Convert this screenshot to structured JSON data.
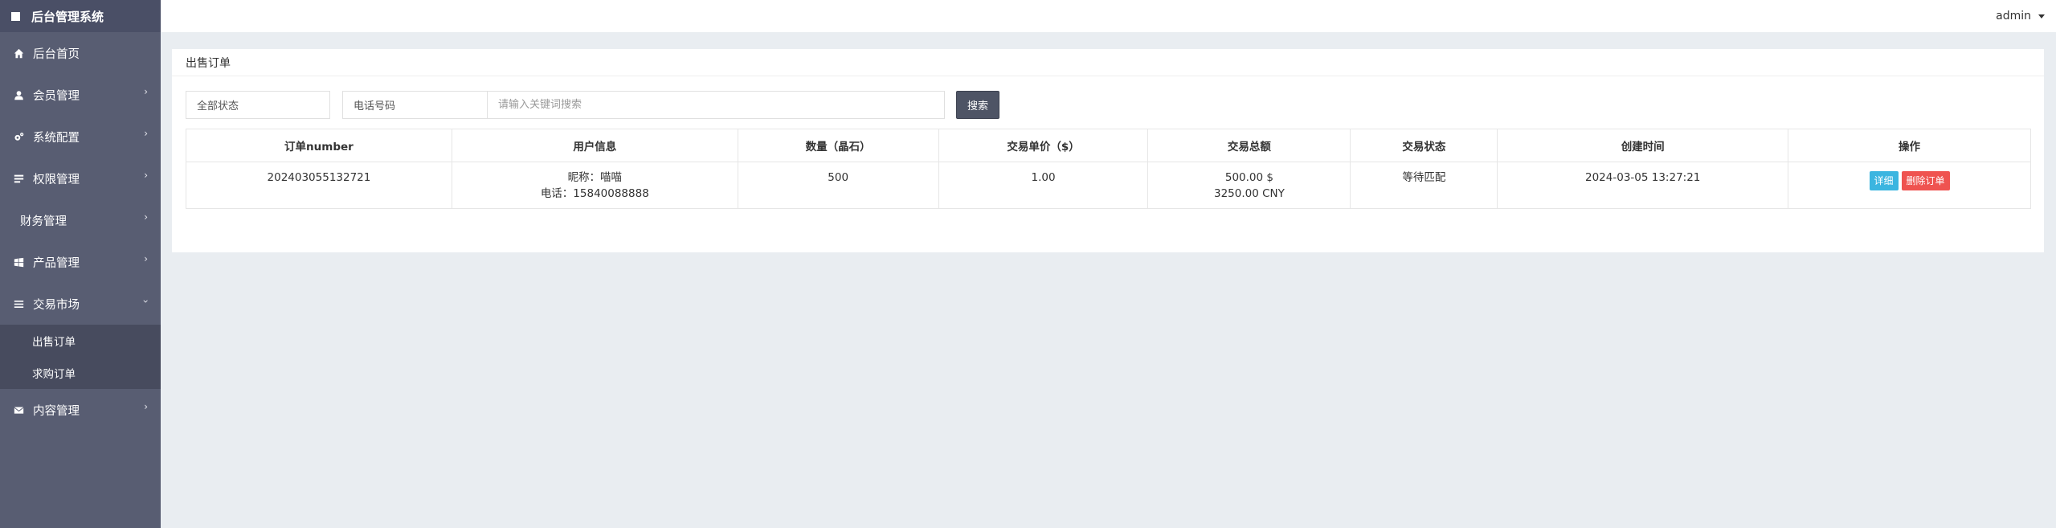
{
  "brand": {
    "title": "后台管理系统"
  },
  "sidebar": {
    "items": [
      {
        "label": "后台首页",
        "icon": "home-icon"
      },
      {
        "label": "会员管理",
        "icon": "user-icon",
        "chevron": "›"
      },
      {
        "label": "系统配置",
        "icon": "cogs-icon",
        "chevron": "›"
      },
      {
        "label": "权限管理",
        "icon": "list-icon",
        "chevron": "›"
      },
      {
        "label": "财务管理",
        "chevron": "›"
      },
      {
        "label": "产品管理",
        "icon": "windows-icon",
        "chevron": "›"
      },
      {
        "label": "交易市场",
        "icon": "bars-icon",
        "chevron": "›"
      },
      {
        "label": "内容管理",
        "icon": "envelope-icon",
        "chevron": "›"
      }
    ],
    "submenu": [
      {
        "label": "出售订单"
      },
      {
        "label": "求购订单"
      }
    ]
  },
  "topbar": {
    "user": "admin"
  },
  "panel": {
    "title": "出售订单"
  },
  "filters": {
    "status": "全部状态",
    "field": "电话号码",
    "keyword_placeholder": "请输入关键词搜索",
    "search_label": "搜索"
  },
  "table": {
    "headers": [
      "订单number",
      "用户信息",
      "数量（晶石）",
      "交易单价（$）",
      "交易总额",
      "交易状态",
      "创建时间",
      "操作"
    ],
    "rows": [
      {
        "order_no": "202403055132721",
        "nickname": "昵称：喵喵",
        "phone": "电话：15840088888",
        "quantity": "500",
        "unit_price": "1.00",
        "total_usd": "500.00 $",
        "total_cny": "3250.00 CNY",
        "status": "等待匹配",
        "created": "2024-03-05 13:27:21",
        "detail_label": "详细",
        "delete_label": "删除订单"
      }
    ]
  },
  "colors": {
    "sidebar_bg": "#585d72",
    "brand_bg": "#4a4f66",
    "submenu_bg": "#474b5e",
    "page_bg": "#e9edf1",
    "search_button": "#4e5465",
    "detail_button": "#3bb5e0",
    "delete_button": "#ef5350"
  }
}
